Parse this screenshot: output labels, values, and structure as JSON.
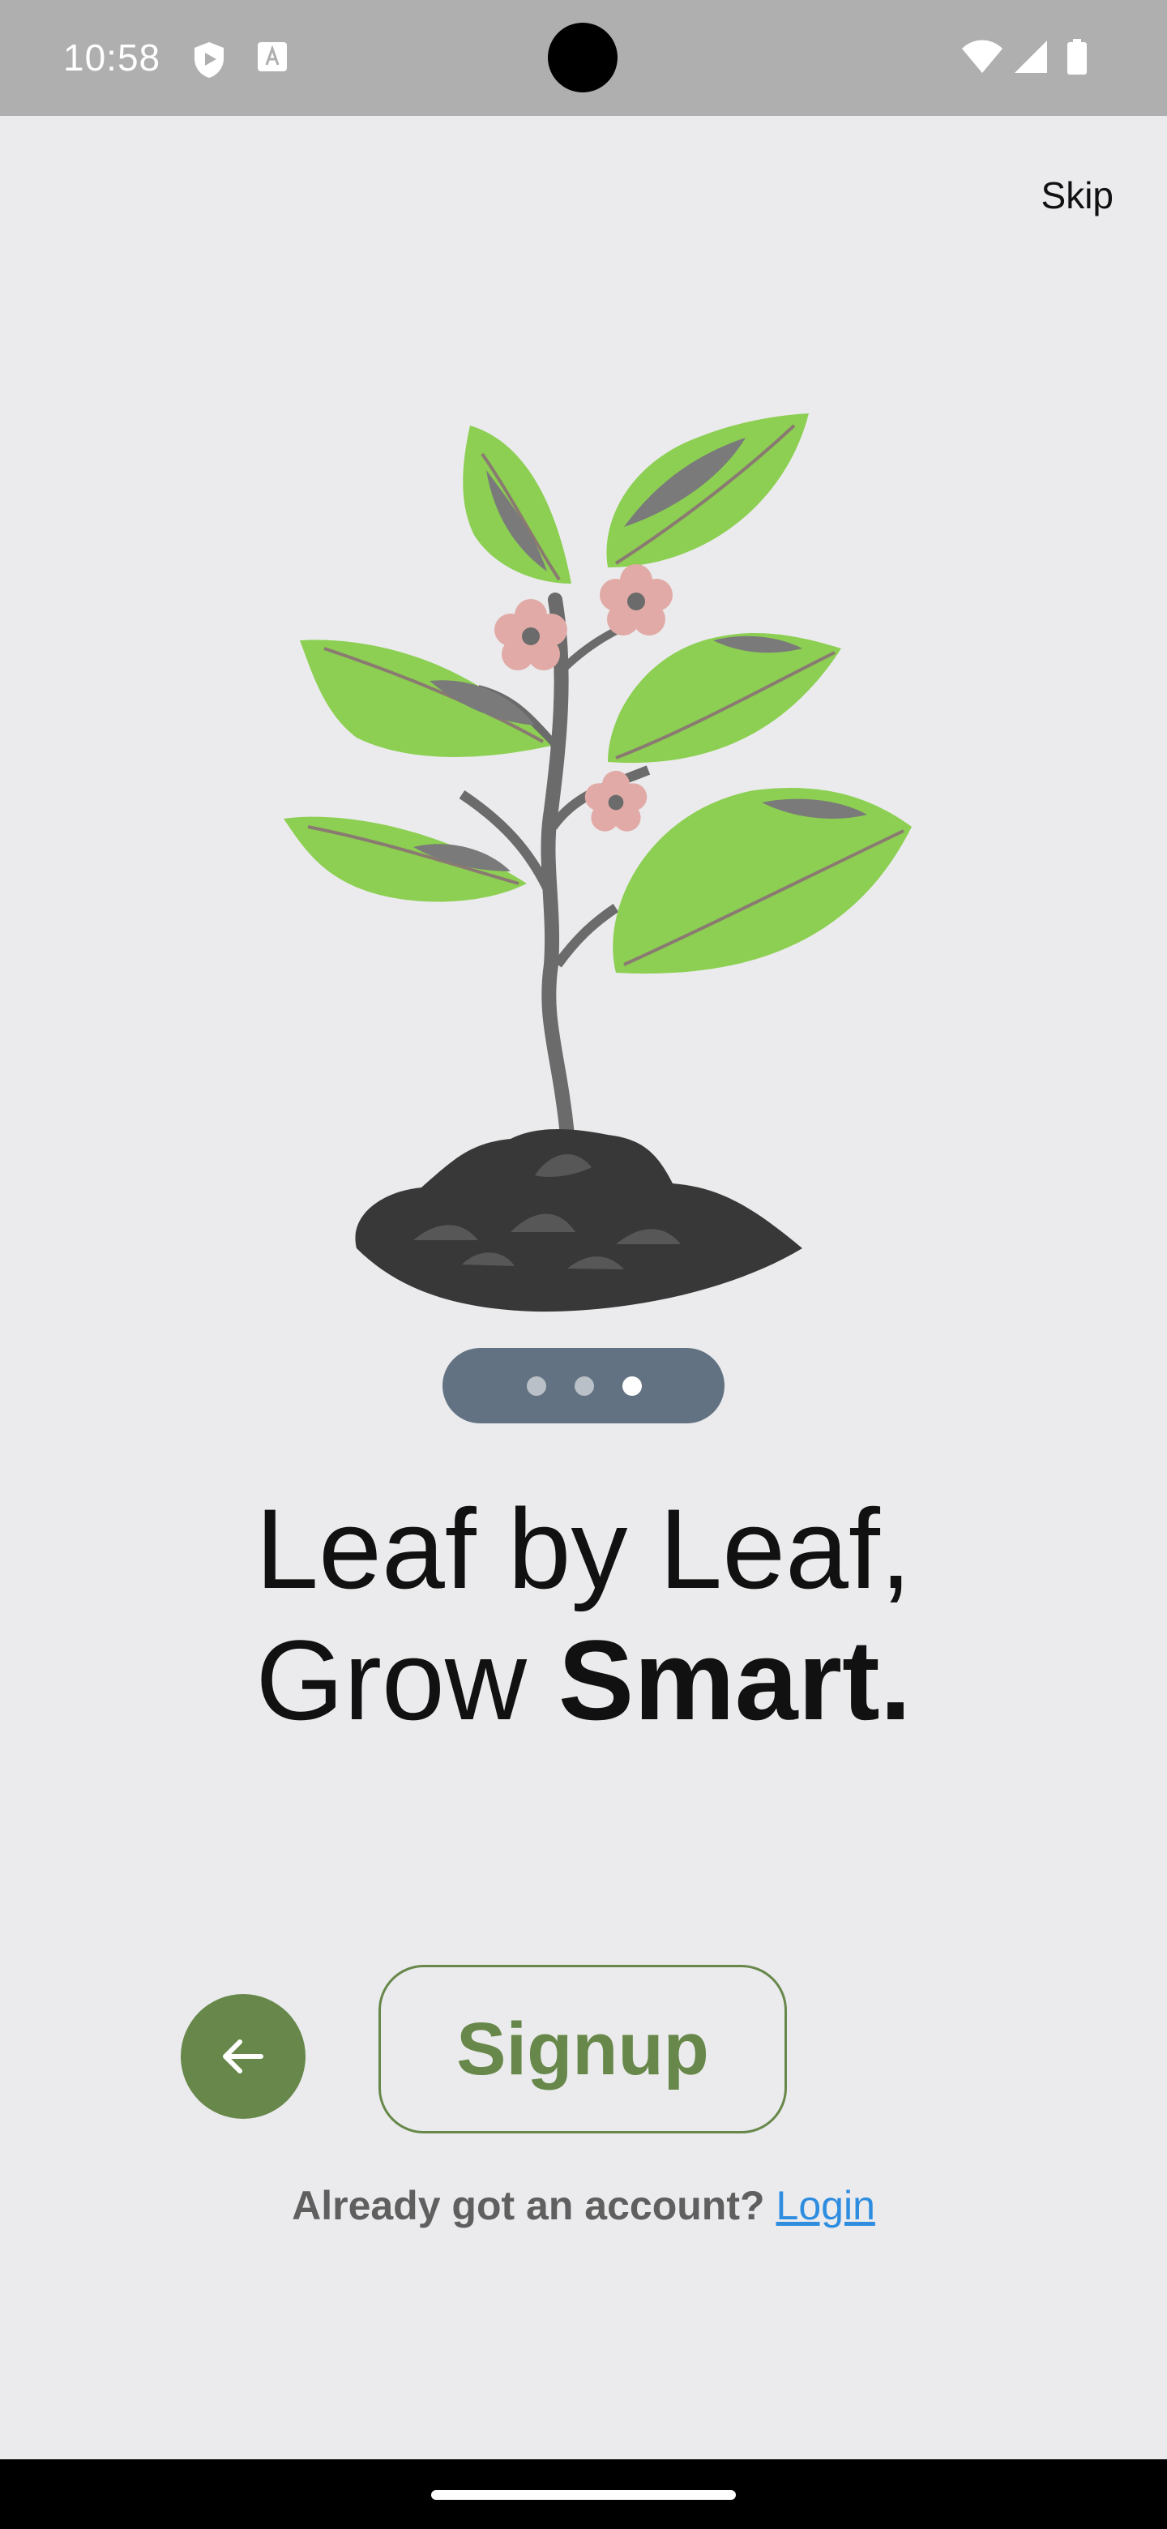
{
  "status_bar": {
    "time": "10:58",
    "left_icons": [
      "shield-play-icon",
      "font-a-icon"
    ],
    "right_icons": [
      "wifi-icon",
      "cellular-signal-icon",
      "battery-icon"
    ]
  },
  "header": {
    "skip_label": "Skip"
  },
  "illustration": {
    "name": "plant-with-flowers-in-soil",
    "colors": {
      "leaf": "#8ccf52",
      "leaf_vein": "#7a7a7a",
      "stem": "#6b6b6b",
      "flower": "#e1aaa6",
      "soil": "#383838"
    }
  },
  "pager": {
    "count": 3,
    "active_index": 2
  },
  "headline": {
    "line1": "Leaf by Leaf,",
    "line2_light": "Grow ",
    "line2_bold": "Smart."
  },
  "actions": {
    "back_icon": "arrow-left-icon",
    "signup_label": "Signup"
  },
  "footer": {
    "prompt": "Already got an account?",
    "login_label": "Login"
  },
  "colors": {
    "background": "#ebebed",
    "accent_green": "#67884a",
    "link_blue": "#2f8de0",
    "pager_bg": "#627282"
  }
}
